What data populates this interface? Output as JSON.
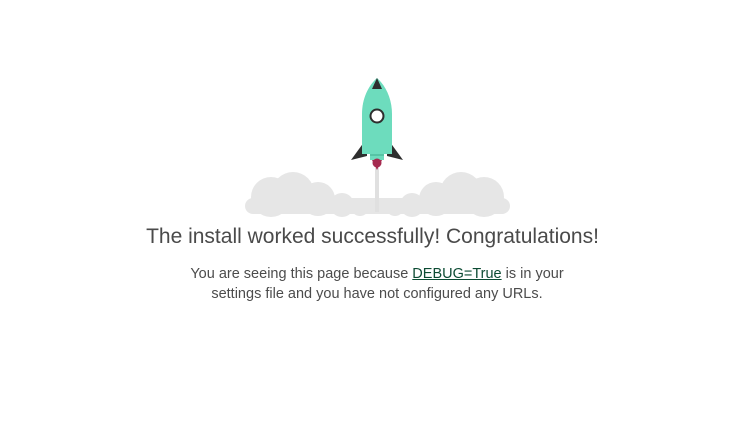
{
  "page": {
    "title": "The install worked successfully! Congratulations!",
    "message_before": "You are seeing this page because ",
    "debug_link": "DEBUG=True",
    "message_after": " is in your settings file and you have not configured any URLs."
  },
  "illustration": {
    "name": "rocket-launch-illustration",
    "rocket_body_color": "#6DDCBD",
    "rocket_fin_color": "#2E2E2E",
    "rocket_window_color": "#ffffff",
    "flame_color": "#A52A4F",
    "smoke_color": "#E6E6E6",
    "trail_color": "#E0E0E0"
  },
  "colors": {
    "link": "#0c4b33",
    "title": "#4a4a4a",
    "text": "#4c4c4c"
  }
}
